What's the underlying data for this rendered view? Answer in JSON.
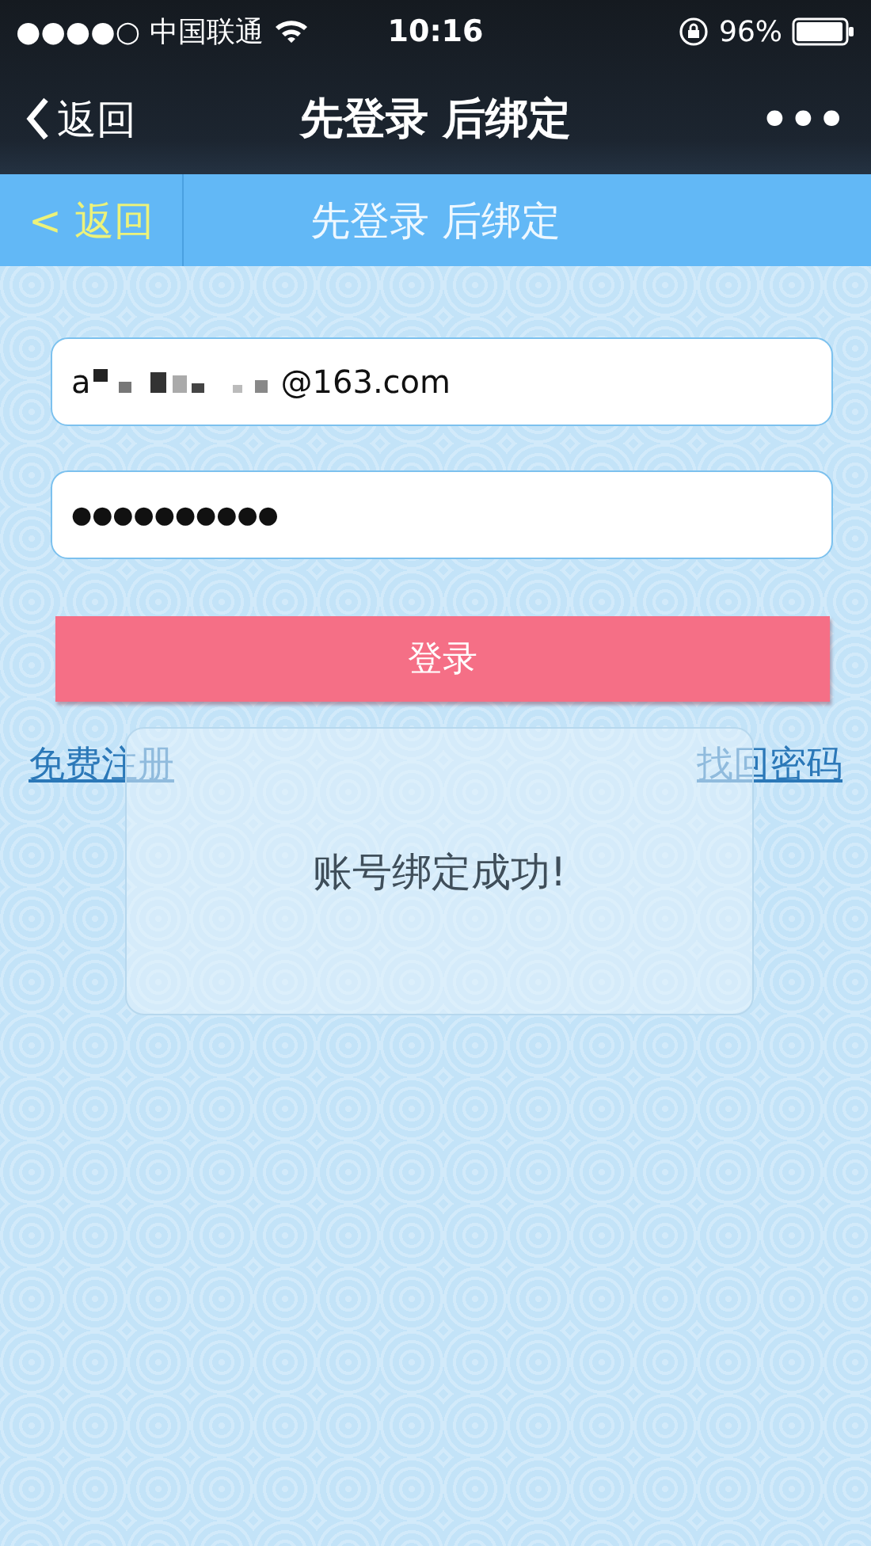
{
  "status_bar": {
    "signal_dots": "●●●●○",
    "carrier": "中国联通",
    "time": "10:16",
    "battery": "96%"
  },
  "nav_bar": {
    "back": "返回",
    "title": "先登录 后绑定",
    "more": "•••"
  },
  "sub_header": {
    "back": "< 返回",
    "title": "先登录 后绑定"
  },
  "form": {
    "email": {
      "visible_start": "a",
      "redacted": true,
      "visible_end": "@163.com"
    },
    "password": {
      "value": "●●●●●●●●●●"
    },
    "login_button": "登录",
    "links": [
      {
        "label": "免费注册"
      },
      {
        "label": "找回密码"
      }
    ]
  },
  "toast": {
    "message": "账号绑定成功!"
  }
}
